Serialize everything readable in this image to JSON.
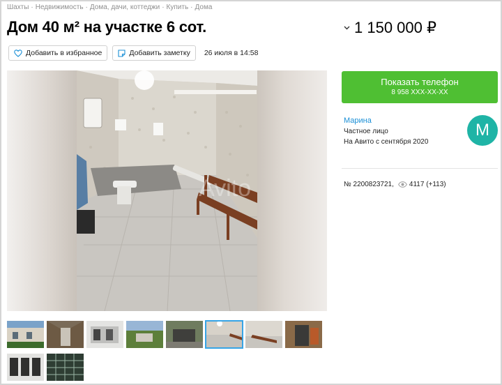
{
  "breadcrumbs": [
    "Шахты",
    "Недвижимость",
    "Дома, дачи, коттеджи",
    "Купить",
    "Дома"
  ],
  "breadcrumb_separator": "·",
  "title": "Дом 40 м² на участке 6 сот.",
  "price": "1 150 000 ₽",
  "actions": {
    "favorite_label": "Добавить в избранное",
    "note_label": "Добавить заметку",
    "date": "26 июля в 14:58"
  },
  "gallery": {
    "watermark": "Avito",
    "thumbnail_count": 10,
    "active_thumbnail": 6
  },
  "contact": {
    "button_label": "Показать телефон",
    "phone_masked": "8 958 XXX-XX-XX"
  },
  "seller": {
    "name": "Марина",
    "type": "Частное лицо",
    "since": "На Авито с сентября 2020",
    "avatar_letter": "M"
  },
  "listing": {
    "number": "№ 2200823721,",
    "views": "4117 (+113)"
  },
  "colors": {
    "phone_button": "#4fbf33",
    "link": "#1a8fd6",
    "avatar": "#1fb4a6",
    "thumb_active": "#36a4e6"
  }
}
